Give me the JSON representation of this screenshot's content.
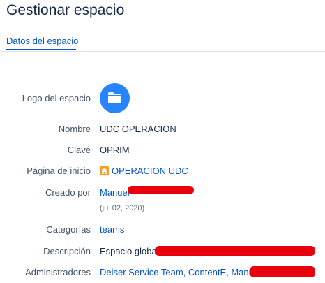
{
  "page": {
    "title": "Gestionar espacio"
  },
  "tabs": [
    {
      "label": "Datos del espacio",
      "active": true
    }
  ],
  "details": {
    "logo_label": "Logo del espacio",
    "logo_icon": "folder-icon",
    "name_label": "Nombre",
    "name_value": "UDC OPERACION",
    "key_label": "Clave",
    "key_value": "OPRIM",
    "home_label": "Página de inicio",
    "home_icon": "home-icon",
    "home_value": "OPERACION UDC",
    "created_label": "Creado por",
    "created_by": "Manuel",
    "created_date": "(jul 02, 2020)",
    "categories_label": "Categorías",
    "categories_value": "teams",
    "description_label": "Descripción",
    "description_value": "Espacio global",
    "admins_label": "Administradores",
    "admins_value": "Deiser Service Team, ContentE, Manuel"
  },
  "colors": {
    "accent": "#0052cc",
    "logo_bg": "#2684ff",
    "home_icon": "#ff991f",
    "redaction": "#e8000d"
  }
}
